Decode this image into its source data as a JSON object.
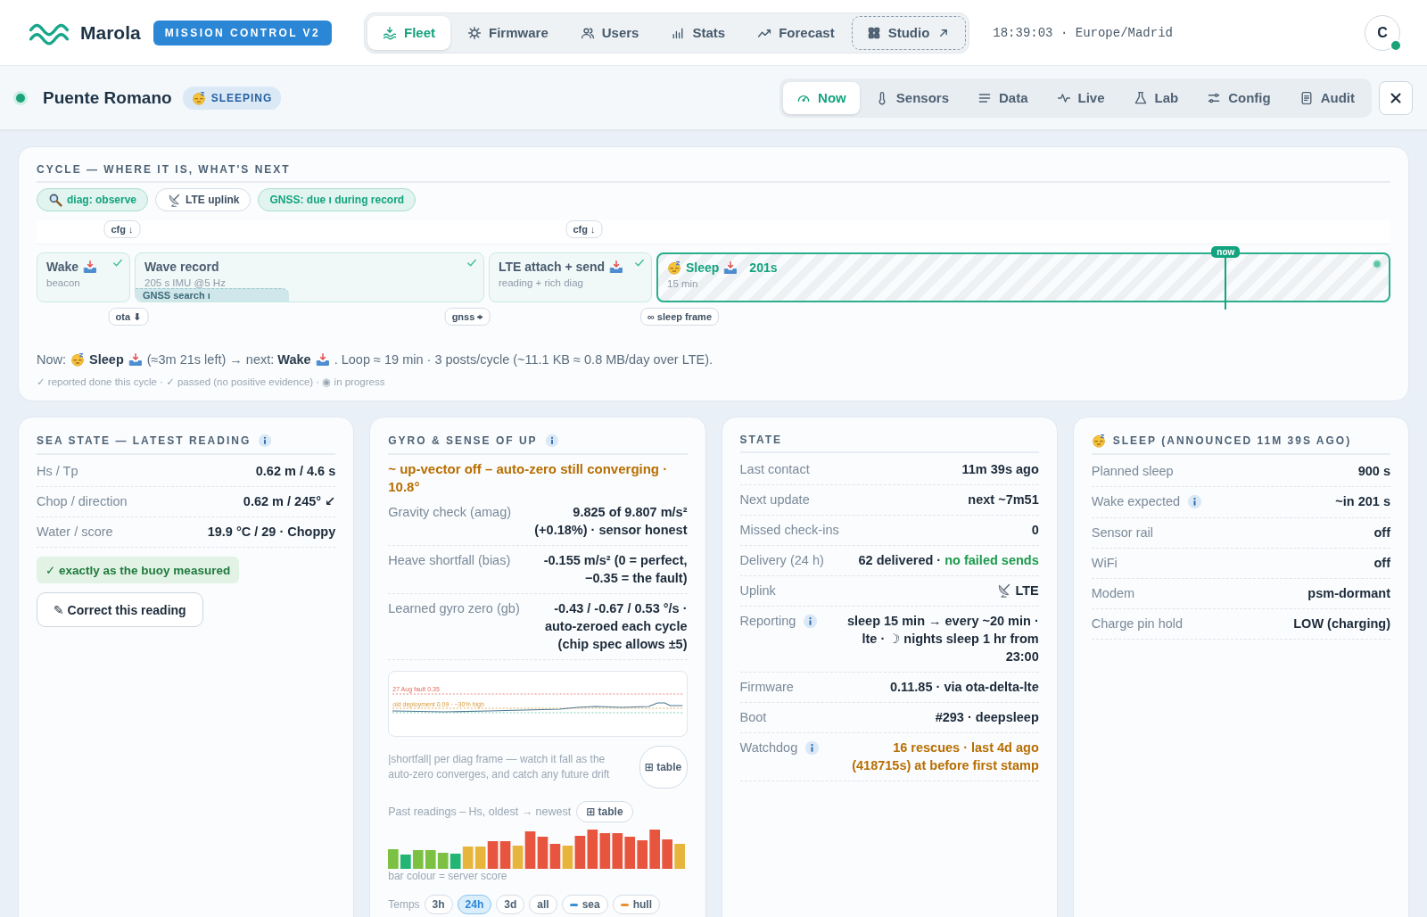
{
  "header": {
    "brand": "Marola",
    "badge": "MISSION CONTROL V2",
    "nav": [
      {
        "label": "Fleet",
        "selected": true,
        "external": false
      },
      {
        "label": "Firmware",
        "selected": false,
        "external": false
      },
      {
        "label": "Users",
        "selected": false,
        "external": false
      },
      {
        "label": "Stats",
        "selected": false,
        "external": false
      },
      {
        "label": "Forecast",
        "selected": false,
        "external": false
      },
      {
        "label": "Studio",
        "selected": false,
        "external": true
      }
    ],
    "clock": "18:39:03 · Europe/Madrid",
    "avatar": {
      "initial": "C",
      "online": true
    }
  },
  "station": {
    "name": "Puente Romano",
    "online": true,
    "state_badge": "SLEEPING",
    "tabs": [
      {
        "label": "Now",
        "selected": true
      },
      {
        "label": "Sensors",
        "selected": false
      },
      {
        "label": "Data",
        "selected": false
      },
      {
        "label": "Live",
        "selected": false
      },
      {
        "label": "Lab",
        "selected": false
      },
      {
        "label": "Config",
        "selected": false
      },
      {
        "label": "Audit",
        "selected": false
      }
    ]
  },
  "cycle": {
    "title": "CYCLE — WHERE IT IS, WHAT'S NEXT",
    "chips": [
      {
        "kind": "magnifier",
        "label": "diag: observe",
        "accent": true
      },
      {
        "kind": "satellite",
        "label": "LTE uplink",
        "accent": false
      },
      {
        "kind": "plain",
        "label": "GNSS: due ı during record",
        "accent": true
      }
    ],
    "markers_top": [
      "cfg ↓",
      "cfg ↓"
    ],
    "markers_bottom": [
      "ota ⬇",
      "gnss ⌖",
      "∞ sleep frame"
    ],
    "stages": [
      {
        "title": "Wake",
        "subtitle": "beacon",
        "done": true,
        "leading_icon": false,
        "trailing_icon": true
      },
      {
        "title": "Wave record",
        "subtitle": "205 s IMU @5 Hz",
        "done": true,
        "leading_icon": false,
        "trailing_icon": false,
        "overlay": "GNSS search ı"
      },
      {
        "title": "LTE attach + send",
        "subtitle": "reading + rich diag",
        "done": true,
        "leading_icon": false,
        "trailing_icon": true
      },
      {
        "title": "Sleep",
        "subtitle": "15 min",
        "done": false,
        "leading_icon": true,
        "trailing_icon": true,
        "countdown": "201s",
        "level": 0.777,
        "now_label": "now"
      }
    ],
    "sentence": [
      {
        "text": "Now:"
      },
      {
        "kind": "sleepy"
      },
      {
        "text": "**Sleep**"
      },
      {
        "kind": "tray"
      },
      {
        "text": "(≈3m 21s left) → next: **Wake**"
      },
      {
        "kind": "tray"
      },
      {
        "text": ". Loop ≈ 19 min · 3 posts/cycle (~11.1 KB ≈ 0.8 MB/day over LTE)."
      }
    ],
    "legend": "✓ reported done this cycle · ✓ passed (no positive evidence) · ◉ in progress"
  },
  "sea": {
    "title": "SEA STATE — LATEST READING",
    "info": true,
    "rows": [
      {
        "label": "Hs / Tp",
        "parts": [
          {
            "text": "0.62 m / 4.6 s"
          }
        ]
      },
      {
        "label": "Chop / direction",
        "parts": [
          {
            "text": "0.62 m / 245° ↙"
          }
        ]
      },
      {
        "label": "Water / score",
        "parts": [
          {
            "text": "19.9 °C / 29 · Choppy"
          }
        ]
      }
    ],
    "verdict": "✓ exactly as the buoy measured",
    "button": "✎ Correct this reading"
  },
  "gyro": {
    "title": "GYRO & SENSE OF UP",
    "info": true,
    "warning": "~ up-vector off – auto-zero still converging · 10.8°",
    "rows": [
      {
        "label": "Gravity check (amag)",
        "parts": [
          {
            "text": "9.825 of 9.807 m/s² (+0.18%) · sensor honest"
          }
        ]
      },
      {
        "label": "Heave shortfall (bias)",
        "parts": [
          {
            "text": "-0.155 m/s² (0 = perfect, −0.35 = the fault)"
          }
        ]
      },
      {
        "label": "Learned gyro zero (gb)",
        "parts": [
          {
            "text": "-0.43 / -0.67 / 0.53 °/s · auto-zeroed each cycle (chip spec allows ±5)"
          }
        ]
      }
    ],
    "spark_labels": [
      "27 Aug fault 0.35",
      "old deployment 0.09 · ~30% high"
    ],
    "spark_caption": "|shortfall| per diag frame — watch it fall as the auto-zero converges, and catch any future drift",
    "spark_button": "⊞ table",
    "history_label": "Past readings – Hs, oldest → newest",
    "history_button": "⊞ table",
    "history_caption": "bar colour = server score",
    "temps_label": "Temps",
    "ranges": [
      {
        "label": "3h",
        "selected": false
      },
      {
        "label": "24h",
        "selected": true
      },
      {
        "label": "3d",
        "selected": false
      },
      {
        "label": "all",
        "selected": false
      }
    ],
    "series": [
      {
        "label": "sea",
        "color": "#3b8fd9"
      },
      {
        "label": "hull",
        "color": "#e8922f"
      }
    ]
  },
  "state": {
    "title": "STATE",
    "rows": [
      {
        "label": "Last contact",
        "parts": [
          {
            "text": "11m 39s ago"
          }
        ]
      },
      {
        "label": "Next update",
        "parts": [
          {
            "text": "next ~7m51"
          }
        ]
      },
      {
        "label": "Missed check-ins",
        "parts": [
          {
            "text": "0"
          }
        ]
      },
      {
        "label": "Delivery (24 h)",
        "parts": [
          {
            "text": "62 delivered ·"
          },
          {
            "text": "no failed sends",
            "good": true
          }
        ]
      },
      {
        "label": "Uplink",
        "parts": [
          {
            "kind": "satellite"
          },
          {
            "text": "LTE"
          }
        ]
      },
      {
        "label": "Reporting",
        "info": true,
        "parts": [
          {
            "text": "sleep 15 min → every ~20 min · lte · ☽ nights sleep 1 hr from 23:00"
          }
        ]
      },
      {
        "label": "Firmware",
        "parts": [
          {
            "text": "0.11.85 · via ota-delta-lte"
          }
        ]
      },
      {
        "label": "Boot",
        "parts": [
          {
            "text": "#293 · deepsleep"
          }
        ]
      },
      {
        "label": "Watchdog",
        "info": true,
        "parts": [
          {
            "text": "16 rescues · last 4d ago (418715s) at before first stamp",
            "warning": true
          }
        ]
      }
    ]
  },
  "sleep": {
    "title": "SLEEP (ANNOUNCED 11M 39S AGO)",
    "rows": [
      {
        "label": "Planned sleep",
        "parts": [
          {
            "text": "900 s"
          }
        ]
      },
      {
        "label": "Wake expected",
        "info": true,
        "parts": [
          {
            "text": "~in 201 s"
          }
        ]
      },
      {
        "label": "Sensor rail",
        "parts": [
          {
            "text": "off"
          }
        ]
      },
      {
        "label": "WiFi",
        "parts": [
          {
            "text": "off"
          }
        ]
      },
      {
        "label": "Modem",
        "parts": [
          {
            "text": "psm-dormant"
          }
        ]
      },
      {
        "label": "Charge pin hold",
        "parts": [
          {
            "text": "LOW (charging)"
          }
        ]
      }
    ]
  }
}
